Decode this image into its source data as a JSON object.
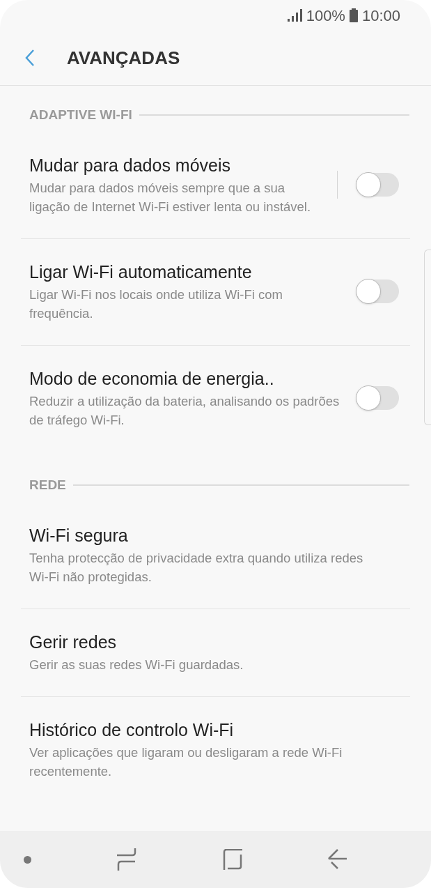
{
  "status_bar": {
    "battery": "100%",
    "time": "10:00"
  },
  "header": {
    "title": "AVANÇADAS"
  },
  "sections": [
    {
      "title": "ADAPTIVE WI-FI",
      "items": [
        {
          "kind": "split-toggle",
          "title": "Mudar para dados móveis",
          "subtitle": "Mudar para dados móveis sempre que a sua ligação de Internet Wi-Fi estiver lenta ou instável.",
          "on": false
        },
        {
          "kind": "toggle",
          "title": "Ligar Wi-Fi automaticamente",
          "subtitle": "Ligar Wi-Fi nos locais onde utiliza Wi-Fi com frequência.",
          "on": false
        },
        {
          "kind": "toggle",
          "title": "Modo de economia de energia..",
          "subtitle": "Reduzir a utilização da bateria, analisando os padrões de tráfego Wi-Fi.",
          "on": false
        }
      ]
    },
    {
      "title": "REDE",
      "items": [
        {
          "kind": "plain",
          "title": "Wi-Fi segura",
          "subtitle": "Tenha protecção de privacidade extra quando utiliza redes Wi-Fi não protegidas."
        },
        {
          "kind": "plain",
          "title": "Gerir redes",
          "subtitle": "Gerir as suas redes Wi-Fi guardadas."
        },
        {
          "kind": "plain",
          "title": "Histórico de controlo Wi-Fi",
          "subtitle": "Ver aplicações que ligaram ou desligaram a rede Wi-Fi recentemente."
        }
      ]
    }
  ]
}
